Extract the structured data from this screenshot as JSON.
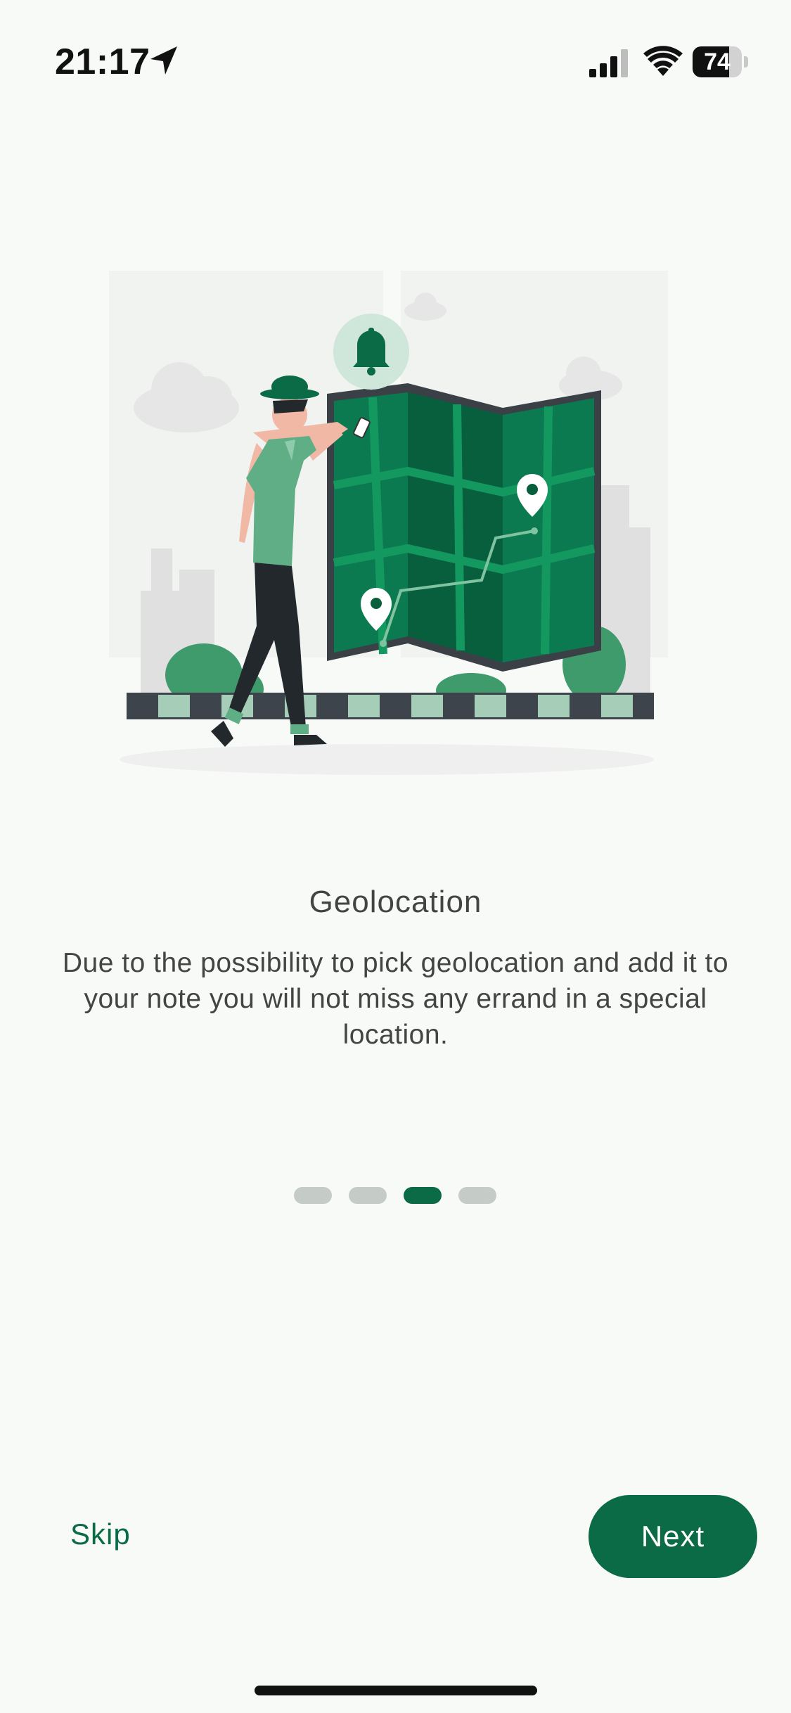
{
  "status_bar": {
    "time": "21:17",
    "battery_level": "74",
    "battery_fraction": 0.74,
    "icons": [
      "location-arrow-icon",
      "cellular-signal-icon",
      "wifi-icon",
      "battery-icon"
    ]
  },
  "onboarding": {
    "illustration": "person-walking-with-map-illustration",
    "title": "Geolocation",
    "description": "Due to the possibility to pick geolocation and add it to your note you will not miss any errand in a special location.",
    "page_count": 4,
    "current_page": 3
  },
  "actions": {
    "skip_label": "Skip",
    "next_label": "Next"
  },
  "colors": {
    "accent": "#0b6b47",
    "background": "#f8faf7",
    "inactive_dot": "#c5cbc6",
    "text": "#444444"
  }
}
